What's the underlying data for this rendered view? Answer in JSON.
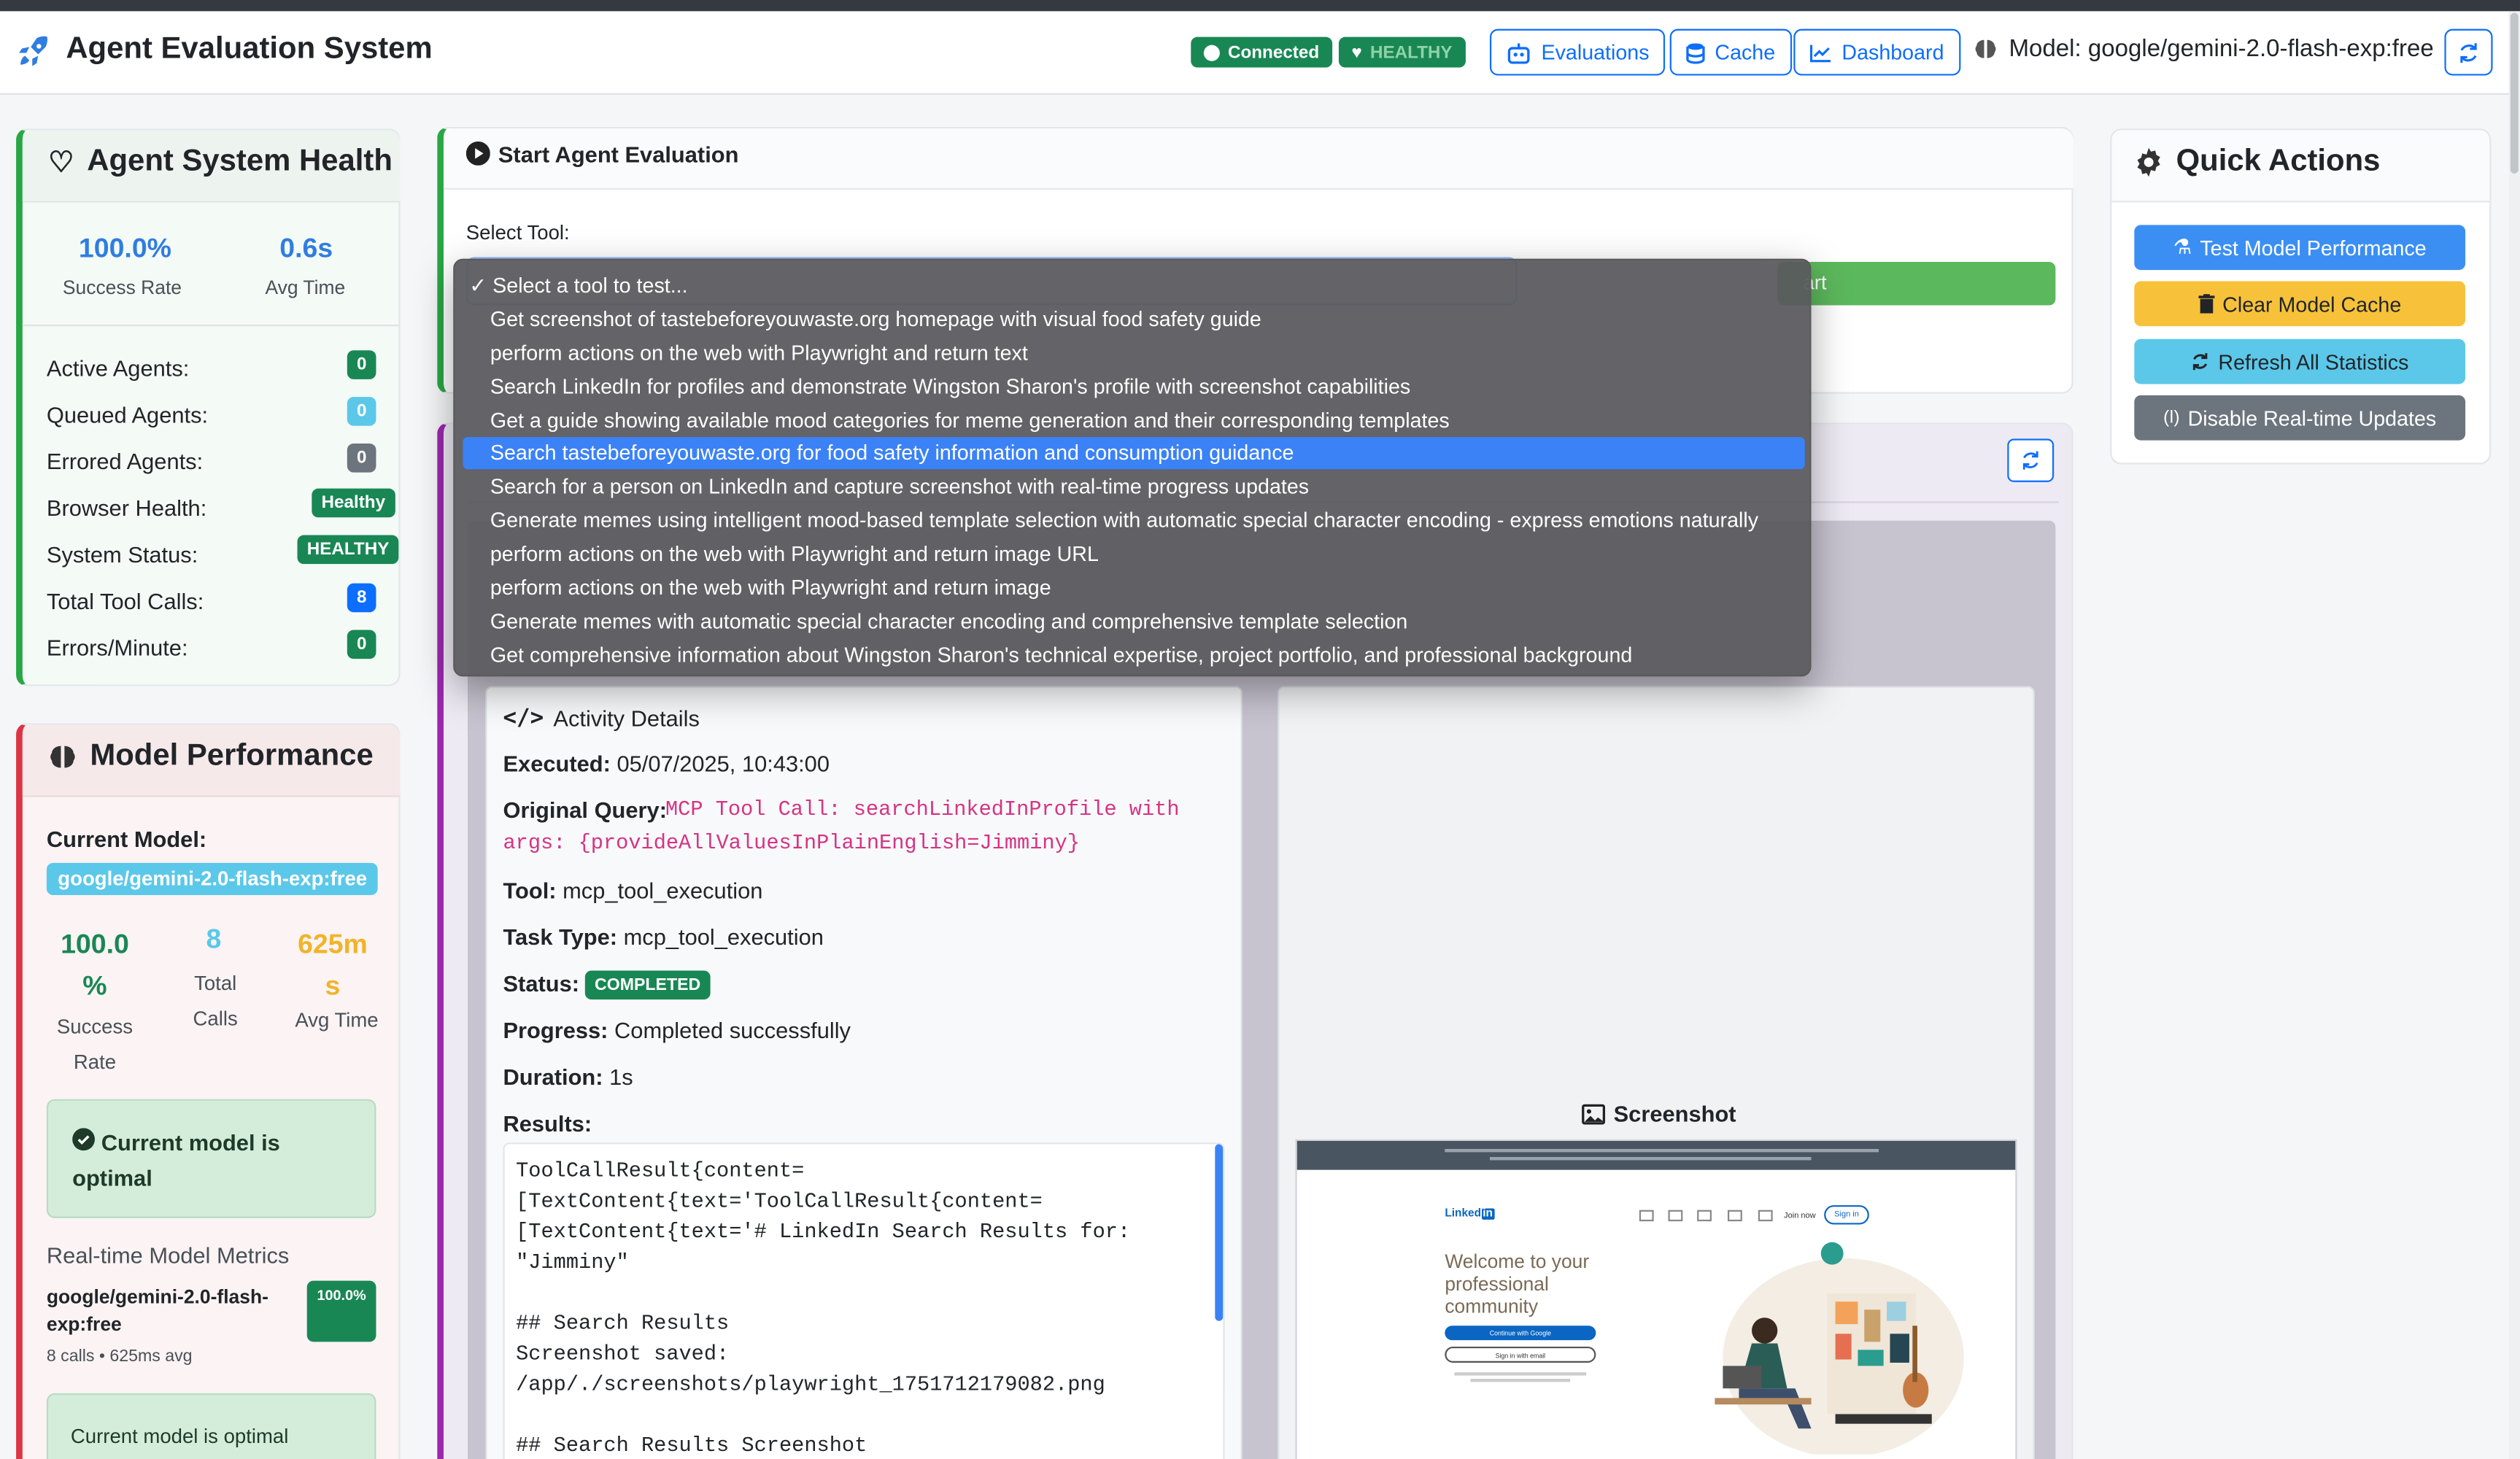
{
  "app": {
    "title": "Agent Evaluation System"
  },
  "header": {
    "connected": "Connected",
    "health": "HEALTHY",
    "nav": {
      "evaluations": "Evaluations",
      "cache": "Cache",
      "dashboard": "Dashboard"
    },
    "model": "Model: google/gemini-2.0-flash-exp:free"
  },
  "health": {
    "title": "Agent System Health",
    "success_rate": "100.0%",
    "success_rate_label": "Success Rate",
    "avg_time": "0.6s",
    "avg_time_label": "Avg Time",
    "rows": [
      {
        "label": "Active Agents:",
        "value": "0"
      },
      {
        "label": "Queued Agents:",
        "value": "0"
      },
      {
        "label": "Errored Agents:",
        "value": "0"
      },
      {
        "label": "Browser Health:",
        "value": "Healthy"
      },
      {
        "label": "System Status:",
        "value": "HEALTHY"
      },
      {
        "label": "Total Tool Calls:",
        "value": "8"
      },
      {
        "label": "Errors/Minute:",
        "value": "0"
      }
    ]
  },
  "model_perf": {
    "title": "Model Performance",
    "current_label": "Current Model:",
    "current_model": "google/gemini-2.0-flash-exp:free",
    "success": "100.0 %",
    "success_label": "Success Rate",
    "calls": "8",
    "calls_label": "Total Calls",
    "avg": "625m s",
    "avg_label": "Avg Time",
    "optimal": "Current model is optimal",
    "realtime_title": "Real-time Model Metrics",
    "realtime_model": "google/gemini-2.0-flash-exp:free",
    "realtime_badge": "100.0%",
    "realtime_sub": "8 calls • 625ms avg",
    "optimal2": "Current model is optimal"
  },
  "start_eval": {
    "title": "Start Agent Evaluation",
    "select_label": "Select Tool:",
    "start_btn_partial": "art"
  },
  "dropdown": {
    "items": [
      "✓ Select a tool to test...",
      "Get screenshot of tastebeforeyouwaste.org homepage with visual food safety guide",
      "perform actions on the web with Playwright and return text",
      "Search LinkedIn for profiles and demonstrate Wingston Sharon's profile with screenshot capabilities",
      "Get a guide showing available mood categories for meme generation and their corresponding templates",
      "Search tastebeforeyouwaste.org for food safety information and consumption guidance",
      "Search for a person on LinkedIn and capture screenshot with real-time progress updates",
      "Generate memes using intelligent mood-based template selection with automatic special character encoding - express emotions naturally",
      "perform actions on the web with Playwright and return image URL",
      "perform actions on the web with Playwright and return image",
      "Generate memes with automatic special character encoding and comprehensive template selection",
      "Get comprehensive information about Wingston Sharon's technical expertise, project portfolio, and professional background"
    ]
  },
  "activity": {
    "title": "Activity Details",
    "executed_label": "Executed:",
    "executed": "05/07/2025, 10:43:00",
    "query_label": "Original Query:",
    "query_line1": "MCP Tool Call: searchLinkedInProfile with",
    "query_line2": "args: {provideAllValuesInPlainEnglish=Jimminy}",
    "tool_label": "Tool:",
    "tool": "mcp_tool_execution",
    "task_label": "Task Type:",
    "task": "mcp_tool_execution",
    "status_label": "Status:",
    "status": "COMPLETED",
    "progress_label": "Progress:",
    "progress": "Completed successfully",
    "duration_label": "Duration:",
    "duration": "1s",
    "results_label": "Results:",
    "results": [
      "ToolCallResult{content=",
      "[TextContent{text='ToolCallResult{content=",
      "[TextContent{text='# LinkedIn Search Results for:",
      "\"Jimminy\"",
      "",
      "## Search Results",
      "Screenshot saved:",
      "/app/./screenshots/playwright_1751712179082.png",
      "",
      "## Search Results Screenshot"
    ]
  },
  "screenshot": {
    "title": "Screenshot",
    "linkedin_logo": "Linked",
    "welcome": "Welcome to your professional community",
    "btn1": "Continue with Google",
    "btn2": "Sign in with email",
    "join": "Join now",
    "signin": "Sign in"
  },
  "quick_actions": {
    "title": "Quick Actions",
    "test": "Test Model Performance",
    "clear": "Clear Model Cache",
    "refresh": "Refresh All Statistics",
    "disable": "Disable Real-time Updates"
  },
  "colors": {
    "success": "#198754",
    "primary": "#0d6efd",
    "warning": "#f7c23a",
    "info": "#5bc8e9",
    "secondary": "#6c757d"
  }
}
